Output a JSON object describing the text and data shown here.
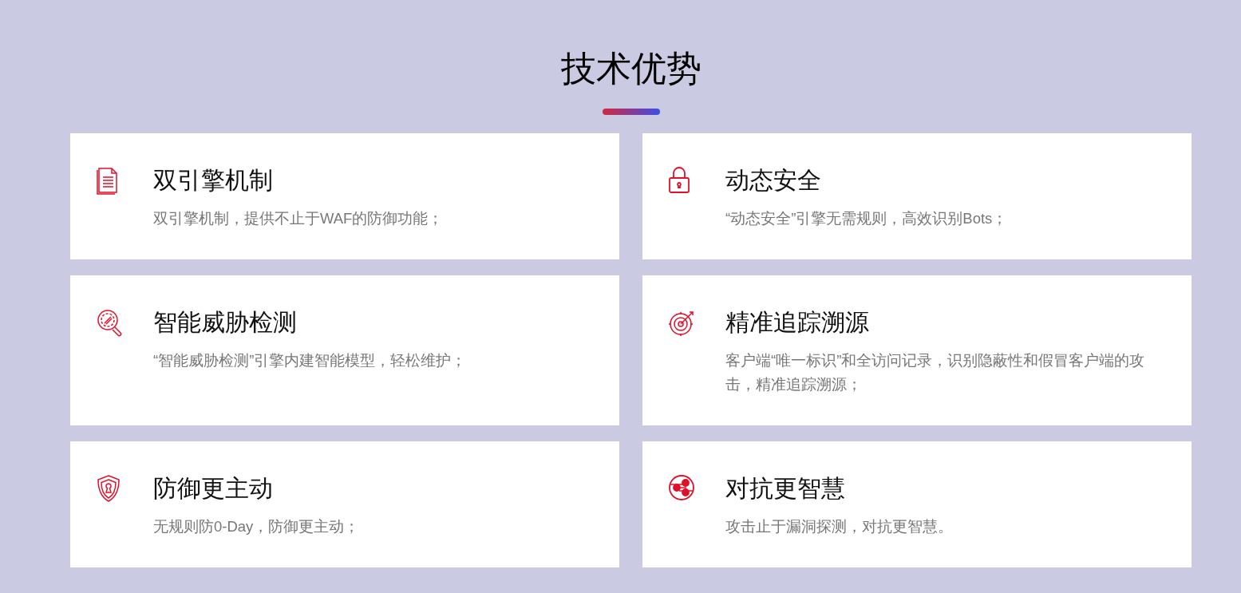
{
  "heading": "技术优势",
  "features": [
    {
      "title": "双引擎机制",
      "description": "双引擎机制，提供不止于WAF的防御功能；"
    },
    {
      "title": "动态安全",
      "description": "“动态安全”引擎无需规则，高效识别Bots；"
    },
    {
      "title": "智能威胁检测",
      "description": "“智能威胁检测”引擎内建智能模型，轻松维护；"
    },
    {
      "title": "精准追踪溯源",
      "description": "客户端“唯一标识”和全访问记录，识别隐蔽性和假冒客户端的攻击，精准追踪溯源；"
    },
    {
      "title": "防御更主动",
      "description": "无规则防0-Day，防御更主动；"
    },
    {
      "title": "对抗更智慧",
      "description": "攻击止于漏洞探测，对抗更智慧。"
    }
  ]
}
